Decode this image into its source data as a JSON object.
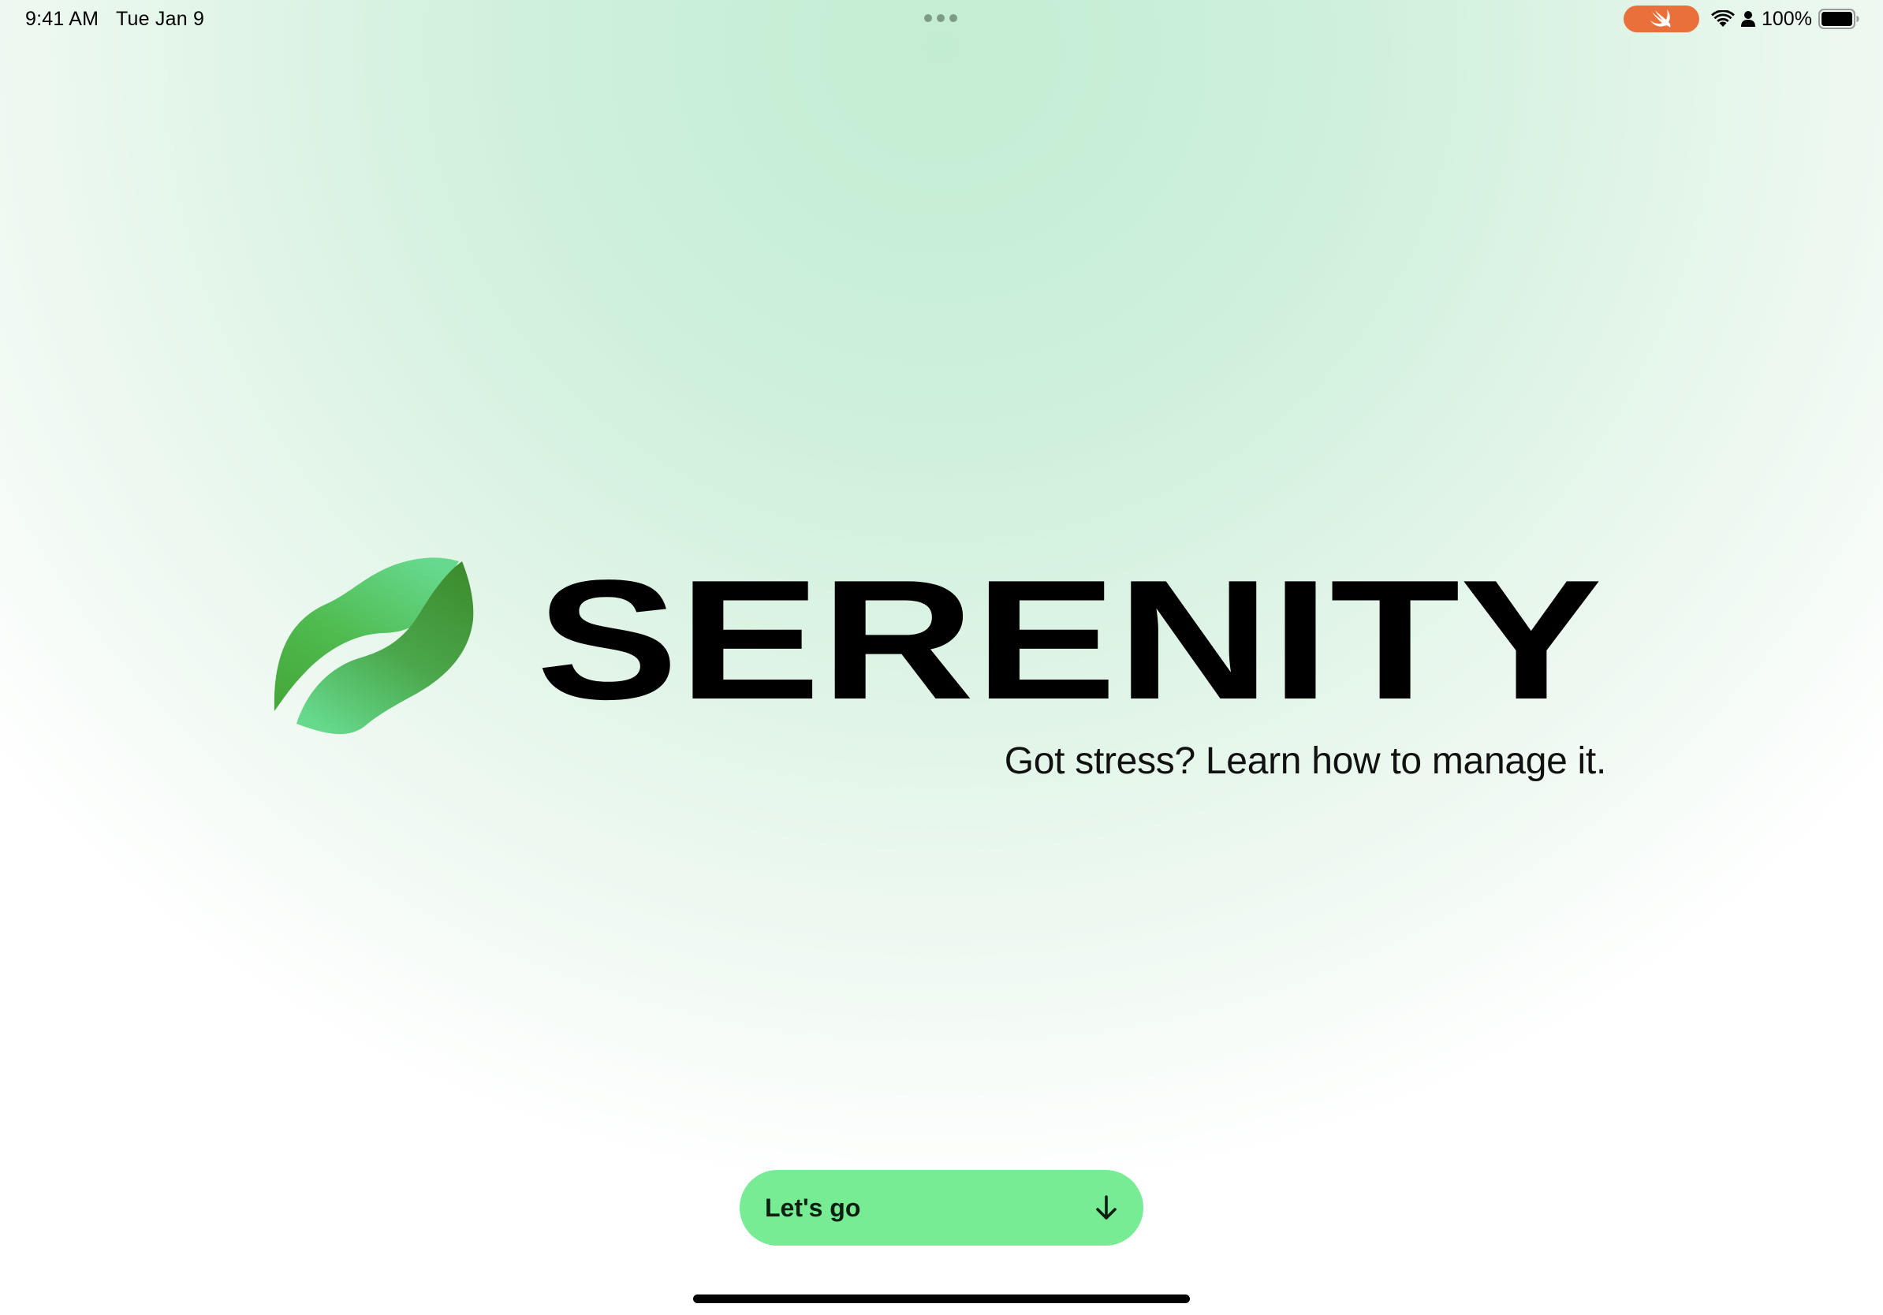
{
  "status_bar": {
    "time": "9:41 AM",
    "date": "Tue Jan 9",
    "battery_percent": "100%",
    "battery_level": 1.0,
    "icons": [
      "multitasking-dots-icon",
      "swift-icon",
      "wifi-icon",
      "person-icon",
      "battery-icon"
    ]
  },
  "hero": {
    "app_name": "SERENITY",
    "tagline": "Got stress? Learn how to manage it.",
    "logo": "leaf-logo-icon"
  },
  "cta": {
    "label": "Let's go",
    "icon": "arrow-down-icon"
  },
  "colors": {
    "background_top": "#c3edd3",
    "background_bottom": "#ffffff",
    "button_fill": "#77ec95",
    "swift_pill": "#e9703a",
    "leaf_light": "#62d98b",
    "leaf_dark": "#3f9434",
    "wordmark": "#000000"
  }
}
